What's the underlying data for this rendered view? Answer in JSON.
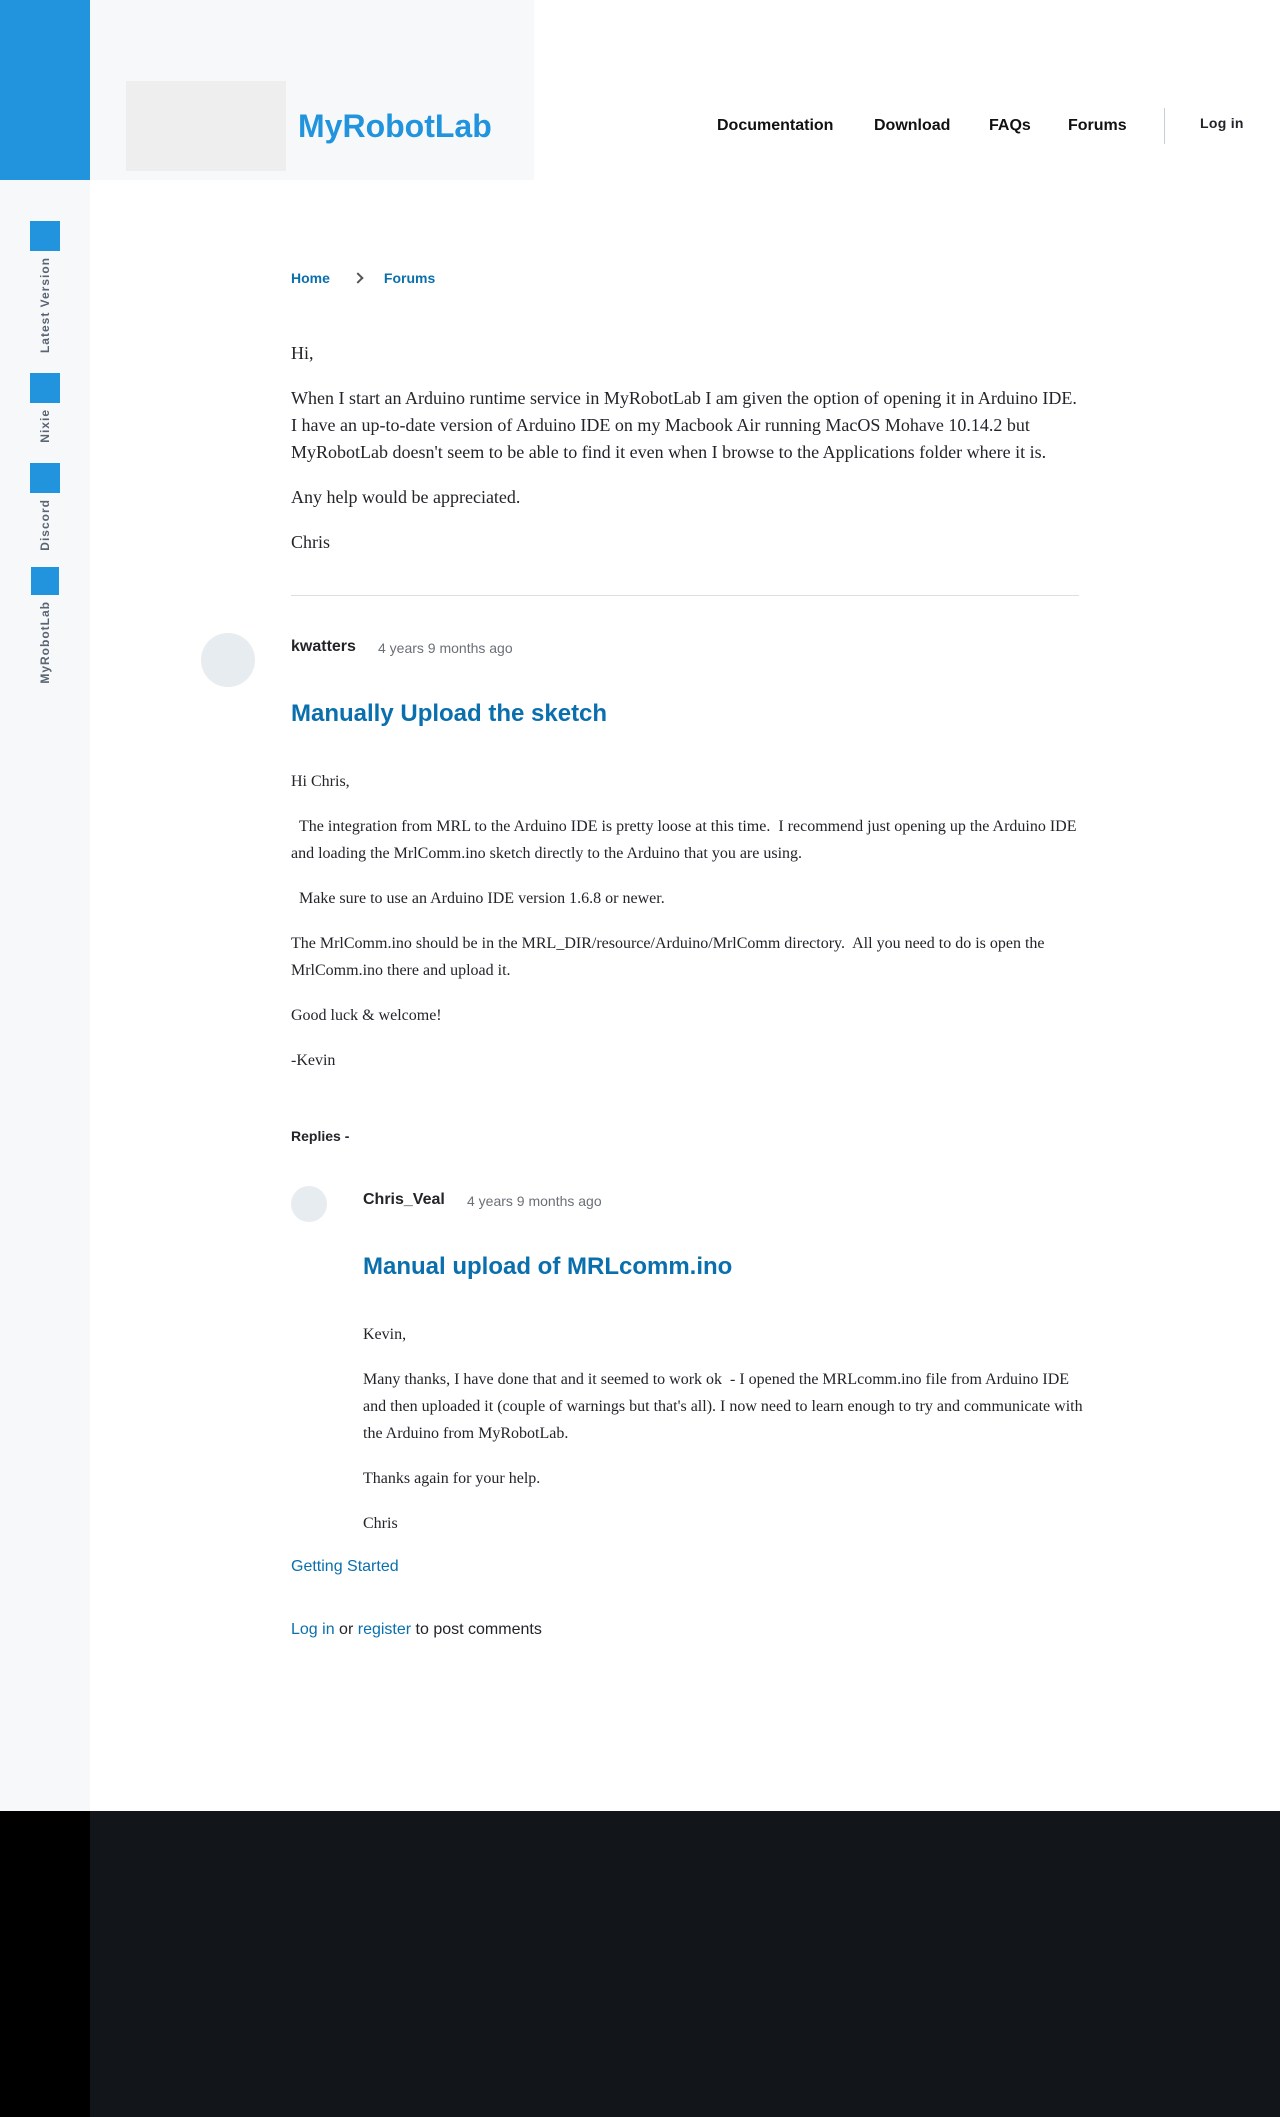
{
  "site": {
    "name": "MyRobotLab"
  },
  "nav": {
    "documentation": "Documentation",
    "download": "Download",
    "faqs": "FAQs",
    "forums": "Forums",
    "login": "Log in"
  },
  "rail": {
    "items": [
      {
        "label": "Latest Version"
      },
      {
        "label": "Nixie"
      },
      {
        "label": "Discord"
      },
      {
        "label": "MyRobotLab"
      }
    ]
  },
  "breadcrumb": {
    "home": "Home",
    "forums": "Forums"
  },
  "post": {
    "paragraphs": [
      "Hi,",
      "When I start an Arduino runtime service in MyRobotLab I am given the option of opening it in Arduino IDE. I have an up-to-date version of Arduino IDE on my Macbook Air running MacOS Mohave 10.14.2 but MyRobotLab doesn't seem to be able to find it even when I browse to the Applications folder where it is.",
      "Any help would be appreciated.",
      "Chris"
    ]
  },
  "comment": {
    "author": "kwatters",
    "time": "4 years 9 months ago",
    "title": "Manually Upload the sketch",
    "paragraphs": [
      "Hi Chris,",
      "  The integration from MRL to the Arduino IDE is pretty loose at this time.  I recommend just opening up the Arduino IDE and loading the MrlComm.ino sketch directly to the Arduino that you are using.",
      "  Make sure to use an Arduino IDE version 1.6.8 or newer.",
      "The MrlComm.ino should be in the MRL_DIR/resource/Arduino/MrlComm directory.  All you need to do is open the MrlComm.ino there and upload it.",
      "Good luck & welcome!",
      "-Kevin"
    ]
  },
  "replies_label": "Replies -",
  "reply": {
    "author": "Chris_Veal",
    "time": "4 years 9 months ago",
    "title": "Manual upload of MRLcomm.ino",
    "paragraphs": [
      "Kevin,",
      "Many thanks, I have done that and it seemed to work ok  - I opened the MRLcomm.ino file from Arduino IDE and then uploaded it (couple of warnings but that's all). I now need to learn enough to try and communicate with the Arduino from MyRobotLab.",
      "Thanks again for your help.",
      "Chris"
    ]
  },
  "tag": "Getting Started",
  "post_comments": {
    "login": "Log in",
    "or": "or",
    "register": "register",
    "suffix": "to post comments"
  },
  "colors": {
    "accent": "#2194dd",
    "link": "#0a6fad",
    "footer": "#121519"
  }
}
